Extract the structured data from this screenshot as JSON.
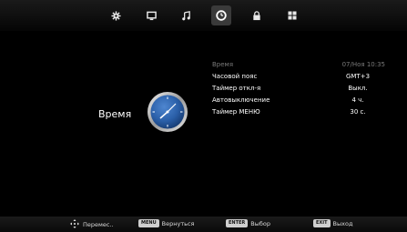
{
  "tabs": [
    {
      "icon": "gear-icon",
      "active": false
    },
    {
      "icon": "monitor-icon",
      "active": false
    },
    {
      "icon": "music-note-icon",
      "active": false
    },
    {
      "icon": "clock-icon",
      "active": true
    },
    {
      "icon": "lock-icon",
      "active": false
    },
    {
      "icon": "grid-icon",
      "active": false
    }
  ],
  "section": {
    "title": "Время"
  },
  "settings": [
    {
      "label": "Время",
      "value": "07/Ноя  10:35",
      "disabled": true
    },
    {
      "label": "Часовой пояс",
      "value": "GMT+3",
      "disabled": false
    },
    {
      "label": "Таймер откл-я",
      "value": "Выкл.",
      "disabled": false
    },
    {
      "label": "Автовыключение",
      "value": "4 ч.",
      "disabled": false
    },
    {
      "label": "Таймер МЕНЮ",
      "value": "30 с.",
      "disabled": false
    }
  ],
  "footer": {
    "move_label": "Перемес..",
    "menu_key": "MENU",
    "menu_label": "Вернуться",
    "enter_key": "ENTER",
    "enter_label": "Выбор",
    "exit_key": "EXIT",
    "exit_label": "Выход"
  },
  "colors": {
    "accent": "#2a5fa8",
    "disabled_text": "#7a7a7a"
  }
}
